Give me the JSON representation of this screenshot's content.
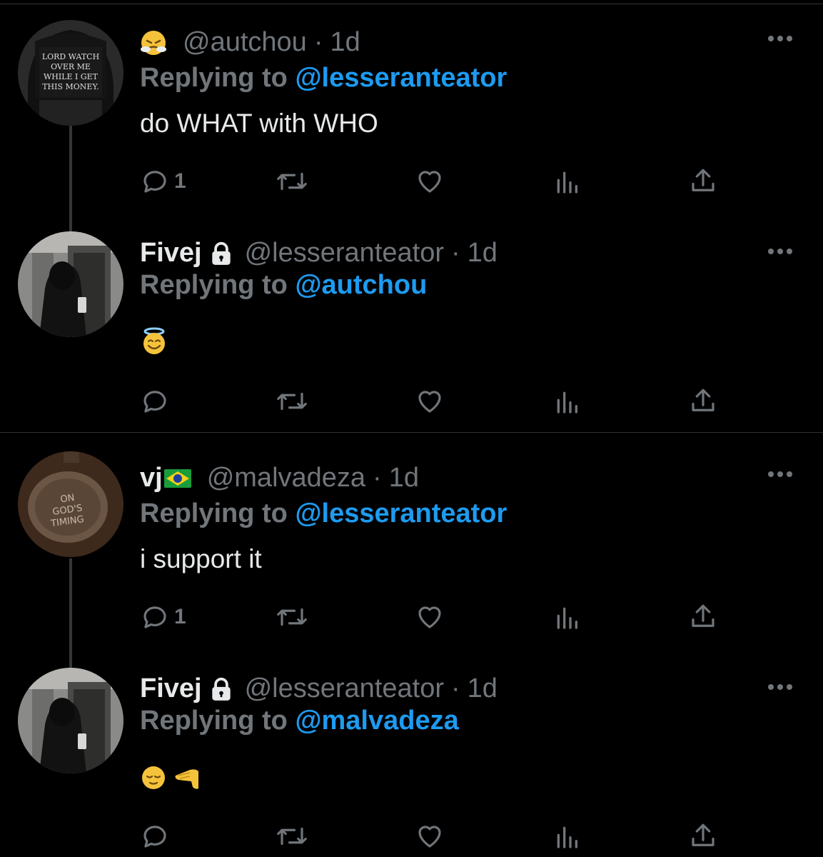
{
  "tweets": [
    {
      "avatar": "black-cap-avatar",
      "avatar_text": "LORD WATCH OVER ME WHILE I GET THIS MONEY",
      "name": "",
      "name_emoji": "face-with-steam-emoji",
      "handle": "@autchou",
      "dot": "·",
      "time": "1d",
      "replying_prefix": "Replying to",
      "replying_to": "@lesseranteator",
      "text": "do WHAT with WHO",
      "reply_count": "1"
    },
    {
      "avatar": "hooded-figure-avatar",
      "name": "Fivej",
      "locked": true,
      "handle": "@lesseranteator",
      "dot": "·",
      "time": "1d",
      "replying_prefix": "Replying to",
      "replying_to": "@autchou",
      "text_emoji": "smiling-face-with-halo-emoji",
      "reply_count": ""
    },
    {
      "avatar": "watch-on-gods-timing-avatar",
      "avatar_text": "ON GOD'S TIMING",
      "name": "vj",
      "flag": "brazil-flag-emoji",
      "handle": "@malvadeza",
      "dot": "·",
      "time": "1d",
      "replying_prefix": "Replying to",
      "replying_to": "@lesseranteator",
      "text": "i support it",
      "reply_count": "1"
    },
    {
      "avatar": "hooded-figure-avatar",
      "name": "Fivej",
      "locked": true,
      "handle": "@lesseranteator",
      "dot": "·",
      "time": "1d",
      "replying_prefix": "Replying to",
      "replying_to": "@malvadeza",
      "text_emoji": "relieved-face-and-saluting-hand-emoji",
      "reply_count": ""
    }
  ],
  "colors": {
    "background": "#000000",
    "text": "#e7e9ea",
    "muted": "#71767b",
    "link": "#1d9bf0",
    "divider": "#2f3336"
  }
}
